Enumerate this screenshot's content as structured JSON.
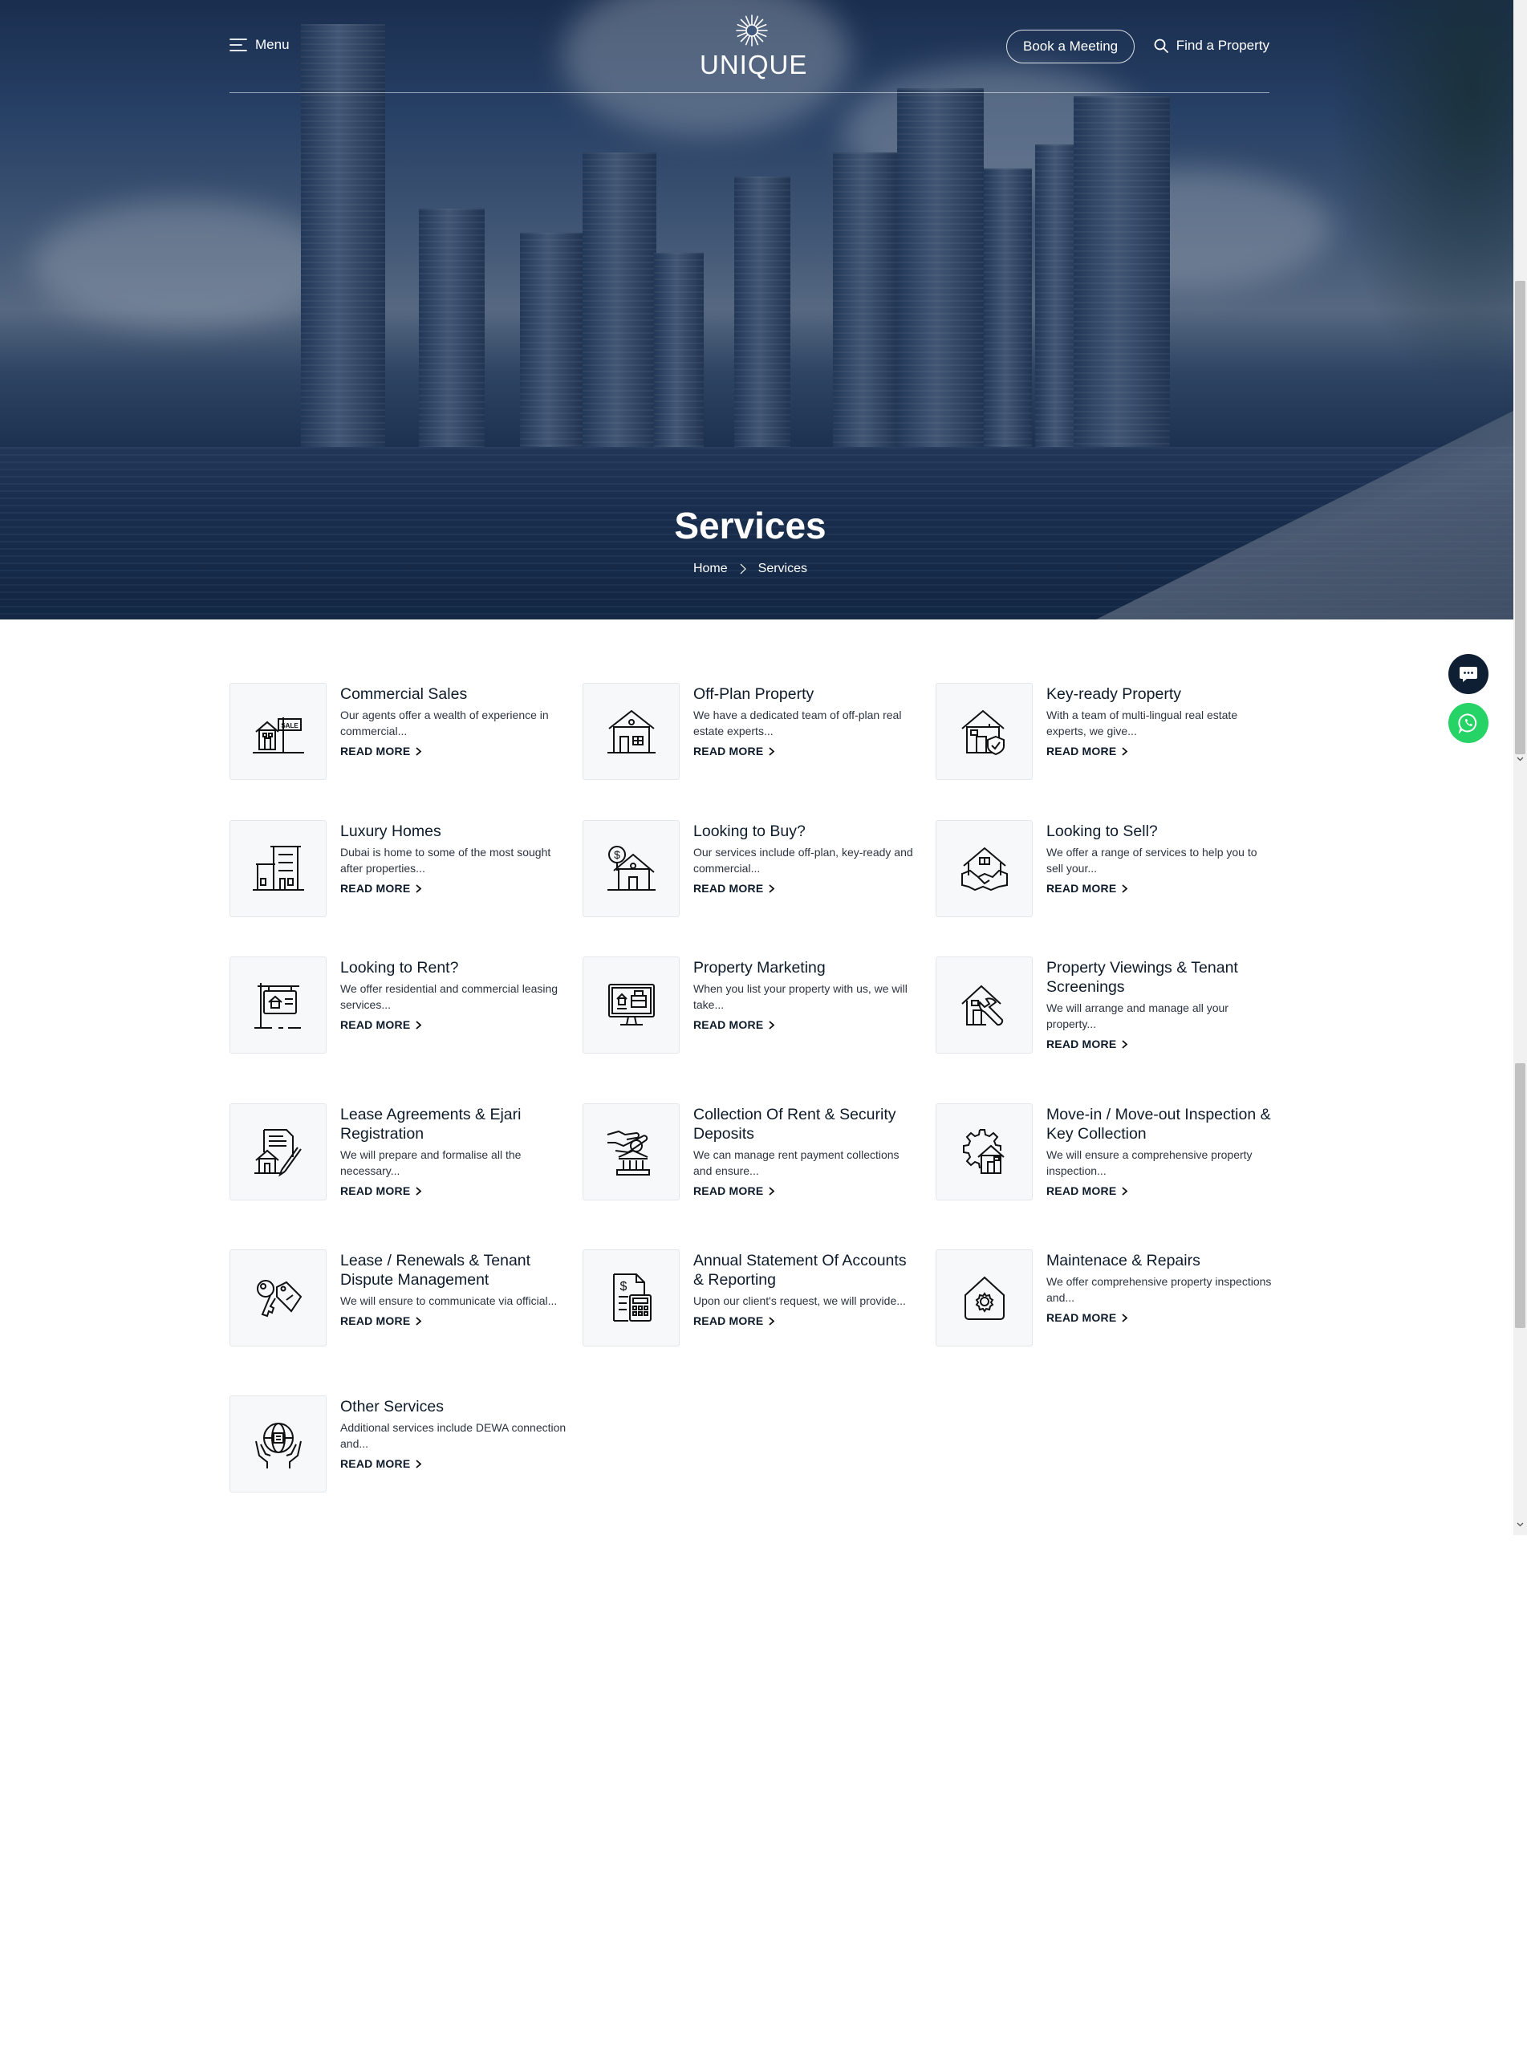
{
  "header": {
    "menu_label": "Menu",
    "logo_text": "UNIQUE",
    "book_label": "Book a Meeting",
    "find_label": "Find a Property"
  },
  "hero": {
    "title": "Services",
    "breadcrumb": [
      "Home",
      "Services"
    ]
  },
  "colors": {
    "navy": "#0f1f33",
    "whatsapp": "#25d366",
    "icon_bg": "#f7f8fa"
  },
  "read_more_label": "READ MORE",
  "services": [
    {
      "title": "Commercial Sales",
      "desc": "Our agents offer a wealth of experience in commercial...",
      "icon": "sale-sign-house-icon"
    },
    {
      "title": "Off-Plan Property",
      "desc": "We have a dedicated team of off-plan real estate experts...",
      "icon": "house-icon"
    },
    {
      "title": "Key-ready Property",
      "desc": "With a team of multi-lingual real estate experts, we give...",
      "icon": "house-shield-icon"
    },
    {
      "title": "Luxury Homes",
      "desc": "Dubai is home to some of the most sought after properties...",
      "icon": "apartment-building-icon"
    },
    {
      "title": "Looking to Buy?",
      "desc": "Our services include off-plan, key-ready and commercial...",
      "icon": "house-dollar-icon"
    },
    {
      "title": "Looking to Sell?",
      "desc": "We offer a range of services to help you to sell your...",
      "icon": "house-handshake-icon"
    },
    {
      "title": "Looking to Rent?",
      "desc": "We offer residential and commercial leasing services...",
      "icon": "rent-sign-icon"
    },
    {
      "title": "Property Marketing",
      "desc": "When you list your property with us, we will take...",
      "icon": "monitor-listing-icon"
    },
    {
      "title": "Property Viewings & Tenant Screenings",
      "desc": "We will arrange and manage all your property...",
      "icon": "house-wrench-icon"
    },
    {
      "title": "Lease Agreements & Ejari Registration",
      "desc": "We will prepare and formalise all the necessary...",
      "icon": "contract-pen-icon"
    },
    {
      "title": "Collection Of Rent & Security Deposits",
      "desc": "We can manage rent payment collections and ensure...",
      "icon": "hand-coin-bank-icon"
    },
    {
      "title": "Move-in / Move-out Inspection & Key Collection",
      "desc": "We will ensure a comprehensive property inspection...",
      "icon": "gear-house-icon"
    },
    {
      "title": "Lease / Renewals & Tenant Dispute Management",
      "desc": "We will ensure to communicate via official...",
      "icon": "key-tag-icon"
    },
    {
      "title": "Annual Statement Of Accounts & Reporting",
      "desc": "Upon our client's request, we will provide...",
      "icon": "invoice-calculator-icon"
    },
    {
      "title": "Maintenace & Repairs",
      "desc": "We offer comprehensive property inspections and...",
      "icon": "house-gear-icon"
    },
    {
      "title": "Other Services",
      "desc": "Additional services include DEWA connection and...",
      "icon": "hands-globe-icon"
    }
  ]
}
